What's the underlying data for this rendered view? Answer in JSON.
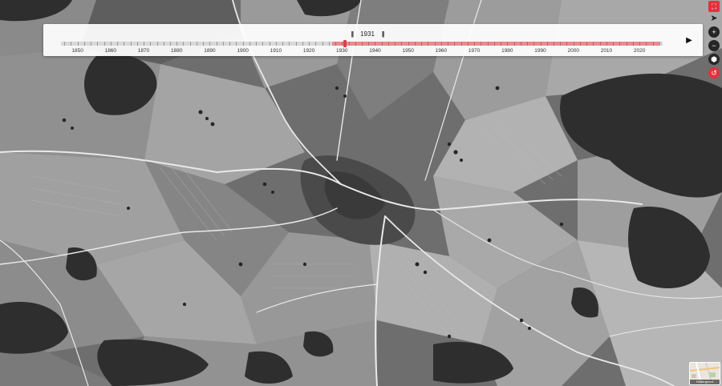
{
  "timeline": {
    "current_year": "1931",
    "play_icon": "play-icon",
    "pause_icon": "pause-icon",
    "years": [
      "1850",
      "1860",
      "1870",
      "1880",
      "1890",
      "1900",
      "1910",
      "1920",
      "1930",
      "1940",
      "1950",
      "1960",
      "1970",
      "1980",
      "1990",
      "2000",
      "2010",
      "2020"
    ],
    "start_year": 1845,
    "end_year": 2027,
    "selected_year": 1931,
    "selected_range": [
      1927,
      2026
    ],
    "colors": {
      "range_fill": "#ec8a8f",
      "thumb": "#d9404a"
    }
  },
  "controls": {
    "fullscreen_icon": "fullscreen-icon",
    "locate_icon": "locate-arrow-icon",
    "zoom_in_label": "+",
    "zoom_out_label": "−",
    "layers_icon": "cube-icon",
    "history_icon": "history-icon"
  },
  "basemap": {
    "label": "Hintergrund",
    "icon": "basemap-thumbnail-icon"
  },
  "colors": {
    "accent": "#e2323e",
    "control": "#262626"
  }
}
